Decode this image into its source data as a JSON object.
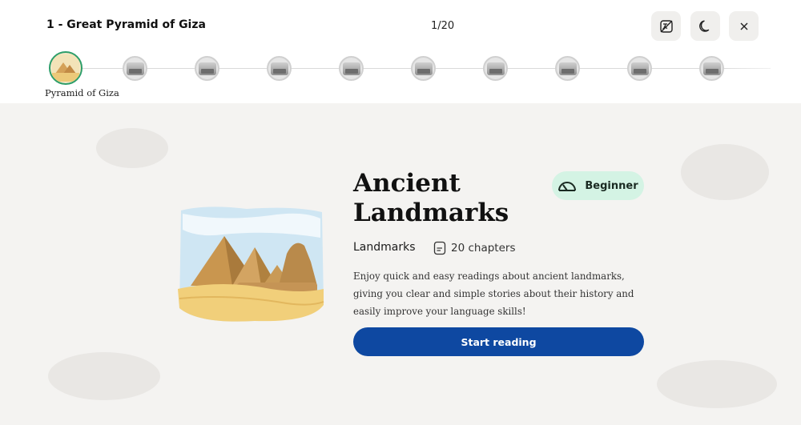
{
  "header": {
    "chapter_title": "1 - Great Pyramid of Giza",
    "page_counter": "1/20",
    "buttons": {
      "translate_icon": "translate-off-icon",
      "theme_icon": "moon-icon",
      "close_icon": "close-icon"
    }
  },
  "timeline": {
    "active_label": "Pyramid of Giza",
    "total_dots_visible": 10,
    "accent_color": "#2e9e6a"
  },
  "book": {
    "title": "Ancient Landmarks",
    "level": "Beginner",
    "category": "Landmarks",
    "chapters": "20 chapters",
    "description": "Enjoy quick and easy readings about ancient landmarks, giving you clear and simple stories about their history and easily improve your language skills!",
    "start_label": "Start reading"
  },
  "colors": {
    "primary_button": "#0e48a1",
    "badge_background": "#d4f3e4",
    "page_background": "#f4f3f1"
  }
}
